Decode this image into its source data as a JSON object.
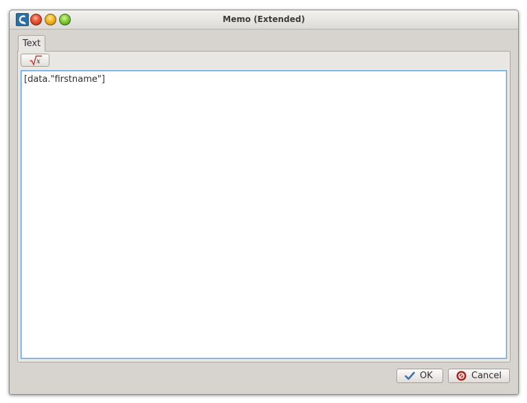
{
  "window": {
    "title": "Memo (Extended)"
  },
  "icons": {
    "app": "app-logo-icon",
    "expression": "square-root-x-icon",
    "ok": "checkmark-icon",
    "cancel": "cancel-circle-icon"
  },
  "tabs": [
    {
      "label": "Text",
      "active": true
    }
  ],
  "toolbar": {
    "expression_button_tooltip": ""
  },
  "editor": {
    "value": "[data.\"firstname\"]"
  },
  "buttons": {
    "ok_label": "OK",
    "cancel_label": "Cancel"
  },
  "colors": {
    "focus_border": "#6aa6d8",
    "titlebar": "#dcdad6",
    "background": "#d7d3cf"
  }
}
